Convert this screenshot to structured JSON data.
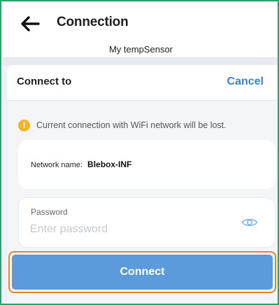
{
  "header": {
    "title": "Connection",
    "subtitle": "My tempSensor"
  },
  "sheet": {
    "title": "Connect to",
    "cancel_label": "Cancel",
    "warning": "Current connection with WiFi network will be lost.",
    "network": {
      "label": "Network name:",
      "value": "Blebox-INF"
    },
    "password": {
      "label": "Password",
      "placeholder": "Enter password",
      "value": ""
    },
    "connect_label": "Connect"
  },
  "colors": {
    "frame_border": "#2aa36b",
    "accent": "#3b82d9",
    "connect_button": "#5b9bdb",
    "highlight_border": "#e6862c",
    "warning": "#f0b429"
  },
  "icons": [
    "back-arrow-icon",
    "warning-icon",
    "eye-icon"
  ]
}
